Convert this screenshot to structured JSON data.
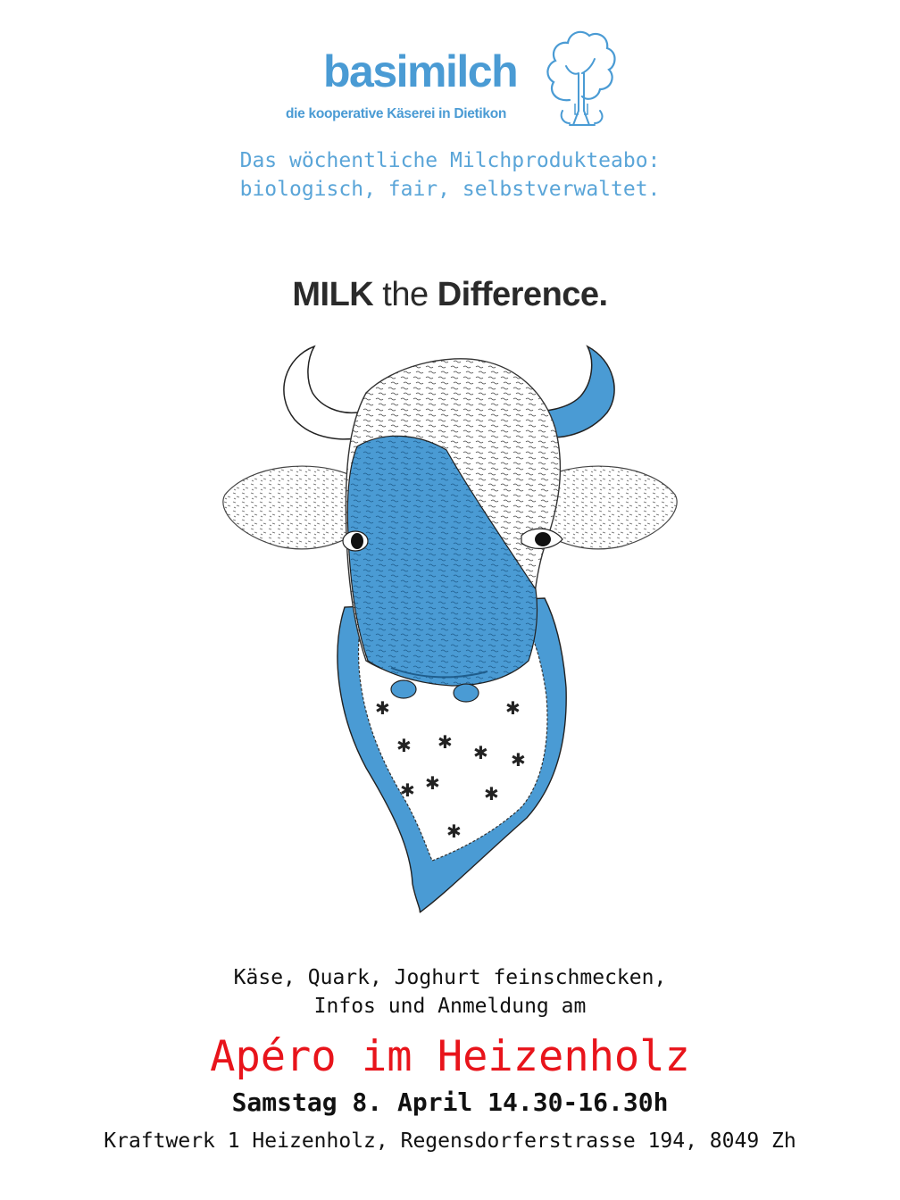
{
  "logo": {
    "name": "basimilch",
    "subtitle": "die kooperative Käserei in Dietikon",
    "color": "#4a9bd4"
  },
  "tagline": {
    "line1": "Das wöchentliche Milchprodukteabo:",
    "line2": "biologisch, fair, selbstverwaltet."
  },
  "slogan": {
    "part1": "MILK",
    "part2": " the ",
    "part3": "Difference."
  },
  "illustration": {
    "icon": "cow-head-illustration",
    "accent_color": "#4a9bd4"
  },
  "info": {
    "line1": "Käse, Quark, Joghurt feinschmecken,",
    "line2": "Infos und Anmeldung am"
  },
  "event": {
    "title": "Apéro im Heizenholz",
    "title_color": "#e8141b",
    "date": "Samstag 8. April 14.30-16.30h",
    "address": "Kraftwerk 1 Heizenholz, Regensdorferstrasse 194, 8049 Zh"
  }
}
